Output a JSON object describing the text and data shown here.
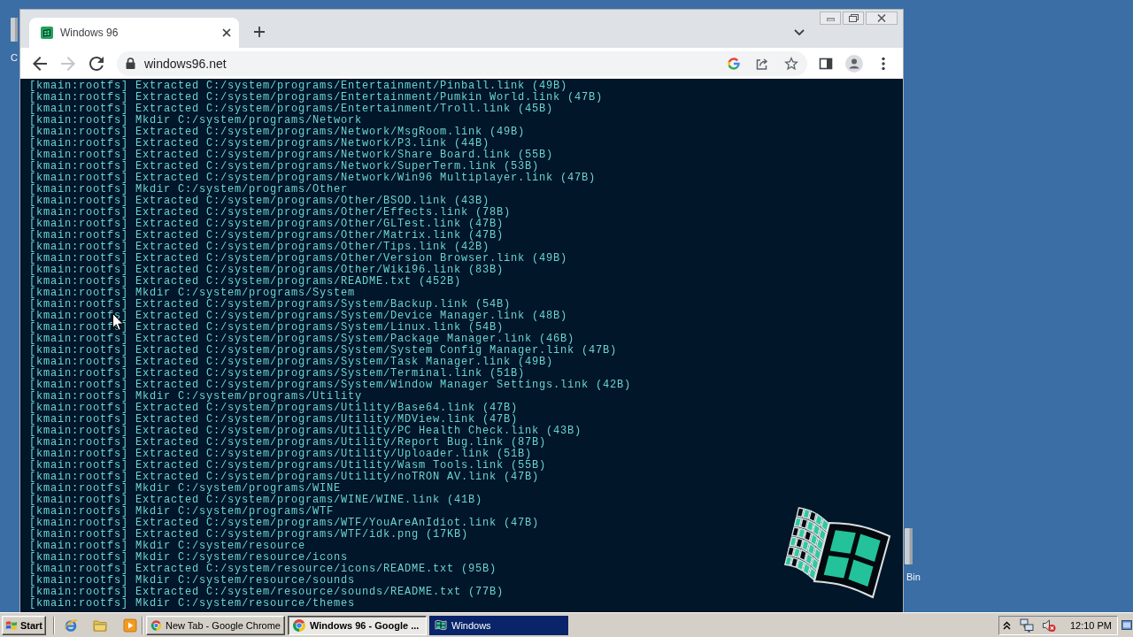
{
  "desktop": {
    "icons": [
      {
        "label": "C"
      },
      {
        "label": "Bin"
      }
    ]
  },
  "browser": {
    "tabs": [
      {
        "title": "Windows 96",
        "selected": true
      }
    ],
    "nav_buttons": [
      {
        "kind": "back",
        "disabled": false
      },
      {
        "kind": "forward",
        "disabled": true
      },
      {
        "kind": "reload",
        "disabled": false
      }
    ],
    "address_bar": {
      "url": "windows96.net"
    },
    "terminal": {
      "lines": [
        "[kmain:rootfs] Extracted C:/system/programs/Entertainment/Pinball.link (49B)",
        "[kmain:rootfs] Extracted C:/system/programs/Entertainment/Pumkin World.link (47B)",
        "[kmain:rootfs] Extracted C:/system/programs/Entertainment/Troll.link (45B)",
        "[kmain:rootfs] Mkdir C:/system/programs/Network",
        "[kmain:rootfs] Extracted C:/system/programs/Network/MsgRoom.link (49B)",
        "[kmain:rootfs] Extracted C:/system/programs/Network/P3.link (44B)",
        "[kmain:rootfs] Extracted C:/system/programs/Network/Share Board.link (55B)",
        "[kmain:rootfs] Extracted C:/system/programs/Network/SuperTerm.link (53B)",
        "[kmain:rootfs] Extracted C:/system/programs/Network/Win96 Multiplayer.link (47B)",
        "[kmain:rootfs] Mkdir C:/system/programs/Other",
        "[kmain:rootfs] Extracted C:/system/programs/Other/BSOD.link (43B)",
        "[kmain:rootfs] Extracted C:/system/programs/Other/Effects.link (78B)",
        "[kmain:rootfs] Extracted C:/system/programs/Other/GLTest.link (47B)",
        "[kmain:rootfs] Extracted C:/system/programs/Other/Matrix.link (47B)",
        "[kmain:rootfs] Extracted C:/system/programs/Other/Tips.link (42B)",
        "[kmain:rootfs] Extracted C:/system/programs/Other/Version Browser.link (49B)",
        "[kmain:rootfs] Extracted C:/system/programs/Other/Wiki96.link (83B)",
        "[kmain:rootfs] Extracted C:/system/programs/README.txt (452B)",
        "[kmain:rootfs] Mkdir C:/system/programs/System",
        "[kmain:rootfs] Extracted C:/system/programs/System/Backup.link (54B)",
        "[kmain:rootfs] Extracted C:/system/programs/System/Device Manager.link (48B)",
        "[kmain:rootfs] Extracted C:/system/programs/System/Linux.link (54B)",
        "[kmain:rootfs] Extracted C:/system/programs/System/Package Manager.link (46B)",
        "[kmain:rootfs] Extracted C:/system/programs/System/System Config Manager.link (47B)",
        "[kmain:rootfs] Extracted C:/system/programs/System/Task Manager.link (49B)",
        "[kmain:rootfs] Extracted C:/system/programs/System/Terminal.link (51B)",
        "[kmain:rootfs] Extracted C:/system/programs/System/Window Manager Settings.link (42B)",
        "[kmain:rootfs] Mkdir C:/system/programs/Utility",
        "[kmain:rootfs] Extracted C:/system/programs/Utility/Base64.link (47B)",
        "[kmain:rootfs] Extracted C:/system/programs/Utility/MDView.link (47B)",
        "[kmain:rootfs] Extracted C:/system/programs/Utility/PC Health Check.link (43B)",
        "[kmain:rootfs] Extracted C:/system/programs/Utility/Report Bug.link (87B)",
        "[kmain:rootfs] Extracted C:/system/programs/Utility/Uploader.link (51B)",
        "[kmain:rootfs] Extracted C:/system/programs/Utility/Wasm Tools.link (55B)",
        "[kmain:rootfs] Extracted C:/system/programs/Utility/noTRON AV.link (47B)",
        "[kmain:rootfs] Mkdir C:/system/programs/WINE",
        "[kmain:rootfs] Extracted C:/system/programs/WINE/WINE.link (41B)",
        "[kmain:rootfs] Mkdir C:/system/programs/WTF",
        "[kmain:rootfs] Extracted C:/system/programs/WTF/YouAreAnIdiot.link (47B)",
        "[kmain:rootfs] Extracted C:/system/programs/WTF/idk.png (17KB)",
        "[kmain:rootfs] Mkdir C:/system/resource",
        "[kmain:rootfs] Mkdir C:/system/resource/icons",
        "[kmain:rootfs] Extracted C:/system/resource/icons/README.txt (95B)",
        "[kmain:rootfs] Mkdir C:/system/resource/sounds",
        "[kmain:rootfs] Extracted C:/system/resource/sounds/README.txt (77B)",
        "[kmain:rootfs] Mkdir C:/system/resource/themes"
      ]
    }
  },
  "taskbar": {
    "start_label": "Start",
    "tasks": [
      {
        "title": "New Tab - Google Chrome",
        "kind": "browser",
        "selected": false,
        "highlighted": false
      },
      {
        "title": "Windows 96 - Google ...",
        "kind": "browser",
        "selected": true,
        "highlighted": false
      },
      {
        "title": "Windows",
        "kind": "app",
        "selected": false,
        "highlighted": true
      }
    ],
    "clock": "12:10 PM"
  }
}
